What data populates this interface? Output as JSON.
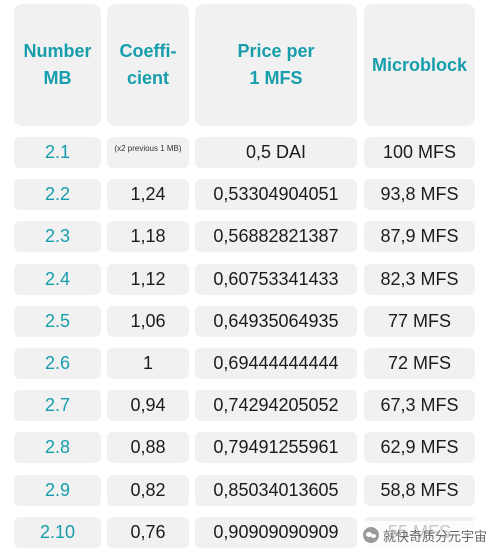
{
  "headers": [
    "Number\nMB",
    "Coeffi-\ncient",
    "Price per\n1 MFS",
    "Microblock"
  ],
  "rows": [
    {
      "number": "2.1",
      "coefficient": "(x2 previous 1 MB)",
      "price": "0,5 DAI",
      "microblock": "100 MFS"
    },
    {
      "number": "2.2",
      "coefficient": "1,24",
      "price": "0,53304904051",
      "microblock": "93,8 MFS"
    },
    {
      "number": "2.3",
      "coefficient": "1,18",
      "price": "0,56882821387",
      "microblock": "87,9 MFS"
    },
    {
      "number": "2.4",
      "coefficient": "1,12",
      "price": "0,60753341433",
      "microblock": "82,3 MFS"
    },
    {
      "number": "2.5",
      "coefficient": "1,06",
      "price": "0,64935064935",
      "microblock": "77 MFS"
    },
    {
      "number": "2.6",
      "coefficient": "1",
      "price": "0,69444444444",
      "microblock": "72 MFS"
    },
    {
      "number": "2.7",
      "coefficient": "0,94",
      "price": "0,74294205052",
      "microblock": "67,3 MFS"
    },
    {
      "number": "2.8",
      "coefficient": "0,88",
      "price": "0,79491255961",
      "microblock": "62,9 MFS"
    },
    {
      "number": "2.9",
      "coefficient": "0,82",
      "price": "0,85034013605",
      "microblock": "58,8 MFS"
    },
    {
      "number": "2.10",
      "coefficient": "0,76",
      "price": "0,90909090909",
      "microblock": "55 MFS"
    }
  ],
  "watermark": {
    "icon": "wechat-icon",
    "text": "就快奇质分元宇宙"
  },
  "colors": {
    "accent": "#169eac",
    "cell_bg": "#f1f1f1",
    "text": "#1c1c1c"
  }
}
